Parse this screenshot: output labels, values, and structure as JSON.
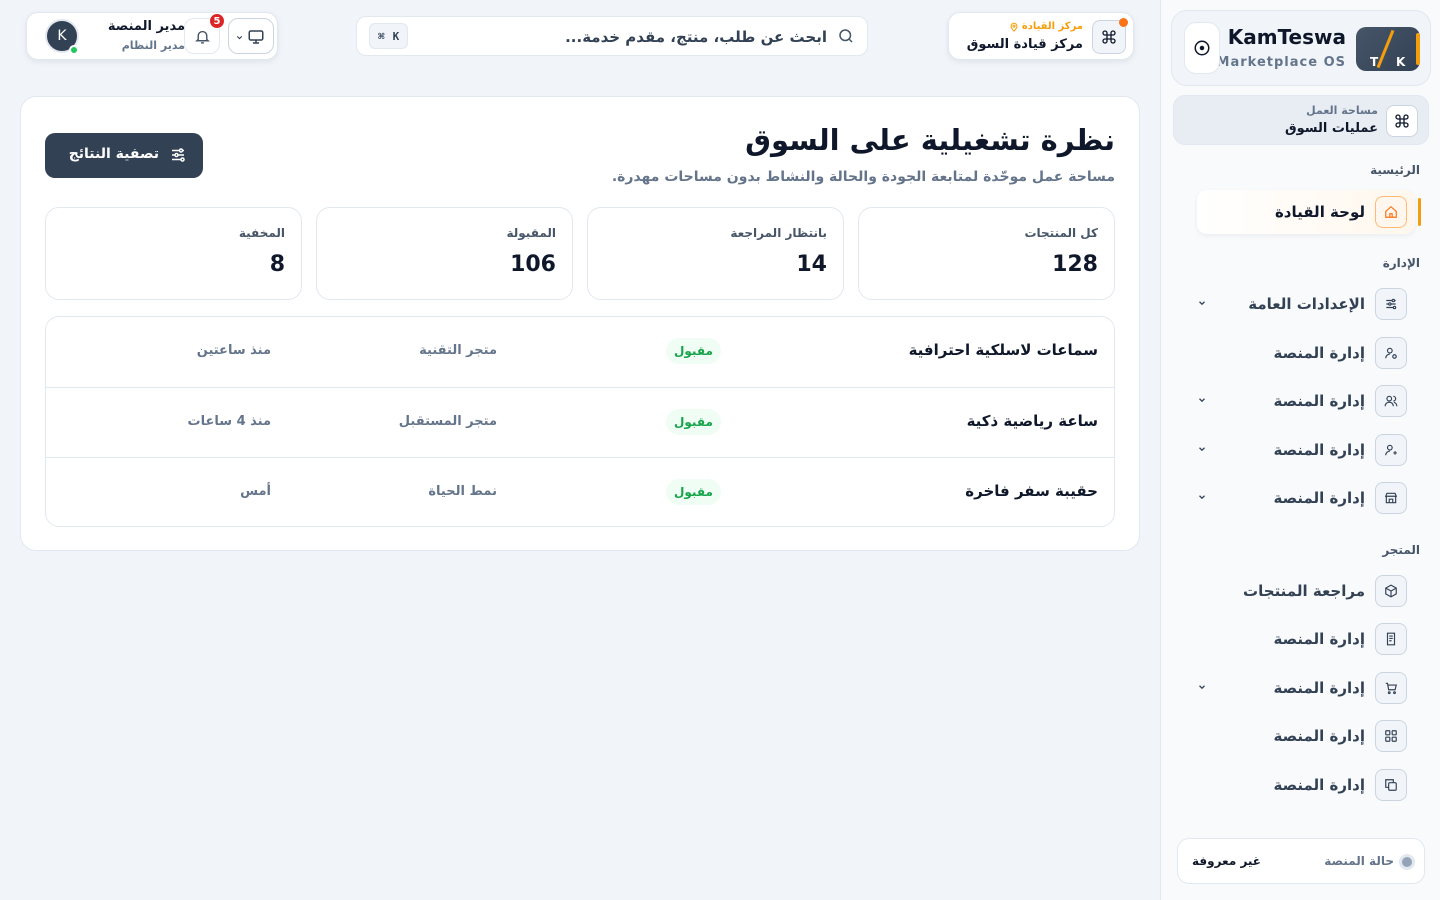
{
  "brand": {
    "name": "KamTeswa",
    "subtitle": "Marketplace OS",
    "logo_letter_left": "T",
    "logo_letter_right": "K"
  },
  "workspace": {
    "label": "مساحة العمل",
    "value": "عمليات السوق"
  },
  "sidebar": {
    "sections": {
      "main": "الرئيسية",
      "admin": "الإدارة",
      "store": "المتجر"
    },
    "items": [
      {
        "label": "لوحة القيادة",
        "icon": "home-icon",
        "active": true,
        "chevron": false
      },
      {
        "label": "الإعدادات العامة",
        "icon": "sliders-icon",
        "active": false,
        "chevron": true
      },
      {
        "label": "إدارة المنصة",
        "icon": "user-cog-icon",
        "active": false,
        "chevron": false
      },
      {
        "label": "إدارة المنصة",
        "icon": "users-icon",
        "active": false,
        "chevron": true
      },
      {
        "label": "إدارة المنصة",
        "icon": "user-plus-icon",
        "active": false,
        "chevron": true
      },
      {
        "label": "إدارة المنصة",
        "icon": "store-icon",
        "active": false,
        "chevron": true
      },
      {
        "label": "مراجعة المنتجات",
        "icon": "package-icon",
        "active": false,
        "chevron": false
      },
      {
        "label": "إدارة المنصة",
        "icon": "receipt-icon",
        "active": false,
        "chevron": false
      },
      {
        "label": "إدارة المنصة",
        "icon": "cart-icon",
        "active": false,
        "chevron": true
      },
      {
        "label": "إدارة المنصة",
        "icon": "grid-icon",
        "active": false,
        "chevron": false
      },
      {
        "label": "إدارة المنصة",
        "icon": "copy-icon",
        "active": false,
        "chevron": false
      }
    ]
  },
  "platform_status": {
    "label": "حالة المنصة",
    "value": "غير معروفة"
  },
  "command_center": {
    "kicker": "مركز القيادة",
    "title": "مركز قيادة السوق"
  },
  "search": {
    "placeholder": "ابحث عن طلب، منتج، مقدم خدمة...",
    "shortcut_mod": "⌘",
    "shortcut_key": "K"
  },
  "user": {
    "name": "مدير المنصة",
    "role": "مدير النظام",
    "initial": "K",
    "notifications": "5"
  },
  "main": {
    "title": "نظرة تشغيلية على السوق",
    "subtitle": "مساحة عمل موحّدة لمتابعة الجودة والحالة والنشاط بدون مساحات مهدرة.",
    "filter_label": "تصفية النتائج",
    "stats": [
      {
        "label": "كل المنتجات",
        "value": "128"
      },
      {
        "label": "بانتظار المراجعة",
        "value": "14"
      },
      {
        "label": "المقبولة",
        "value": "106"
      },
      {
        "label": "المخفية",
        "value": "8"
      }
    ],
    "rows": [
      {
        "name": "سماعات لاسلكية احترافية",
        "status": "مقبول",
        "store": "متجر التقنية",
        "time": "منذ ساعتين"
      },
      {
        "name": "ساعة رياضية ذكية",
        "status": "مقبول",
        "store": "متجر المستقبل",
        "time": "منذ 4 ساعات"
      },
      {
        "name": "حقيبة سفر فاخرة",
        "status": "مقبول",
        "store": "نمط الحياة",
        "time": "أمس"
      }
    ]
  },
  "colors": {
    "accent": "#f59e0b",
    "primary": "#334155",
    "success": "#16a34a",
    "danger": "#dc2626"
  }
}
